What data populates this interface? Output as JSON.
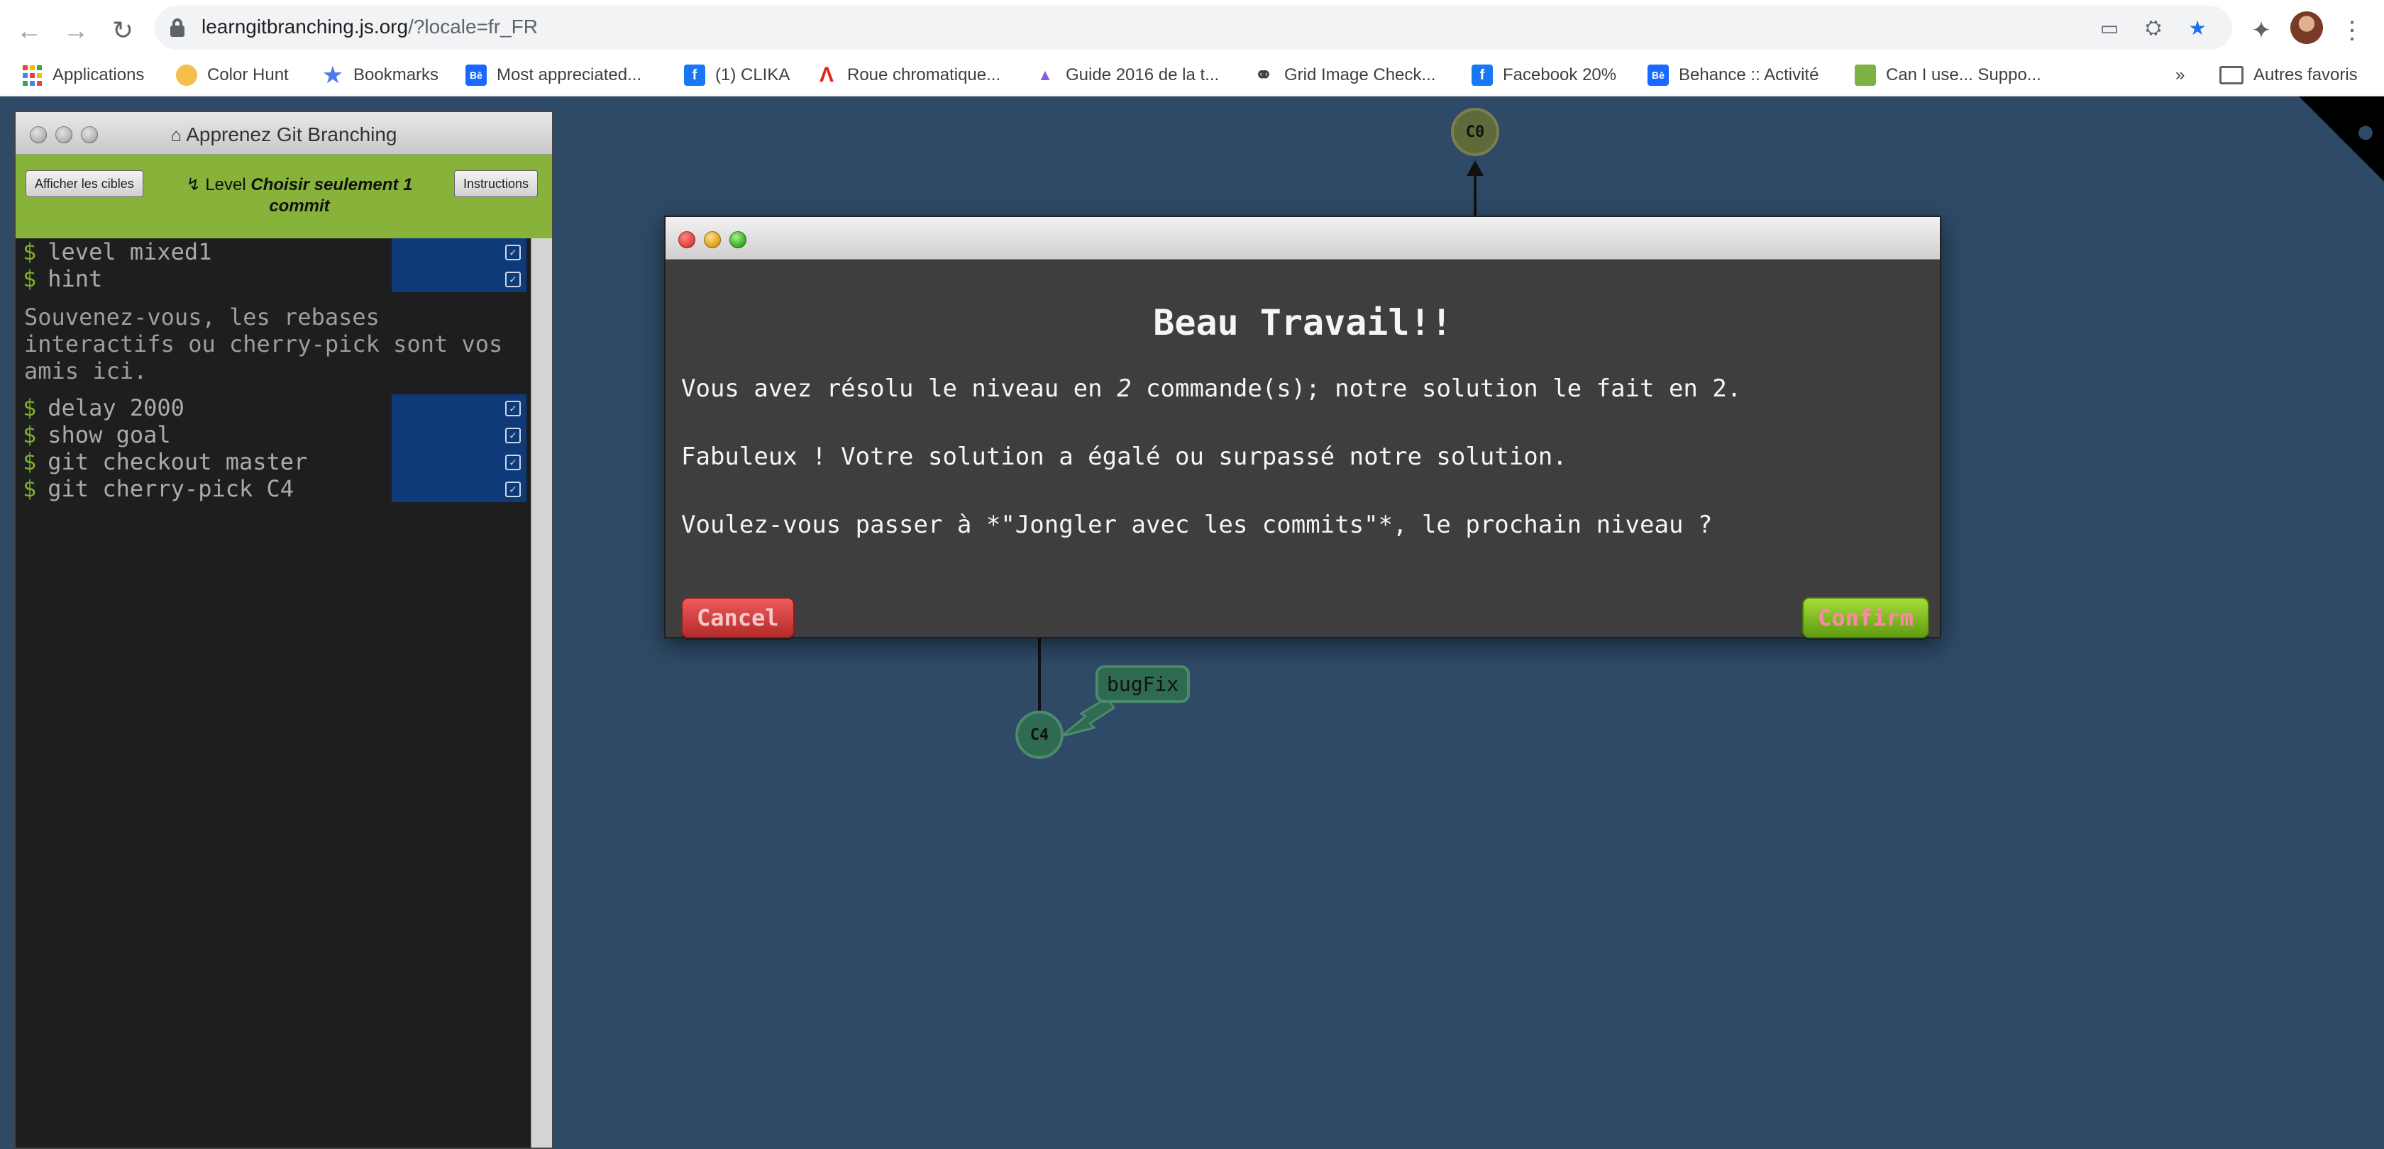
{
  "browser": {
    "url_host": "learngitbranching.js.org",
    "url_path": "/?locale=fr_FR",
    "bookmarks": [
      {
        "label": "Applications",
        "icon": "apps-grid-icon"
      },
      {
        "label": "Color Hunt",
        "icon": "color-hunt-icon"
      },
      {
        "label": "Bookmarks",
        "icon": "star-icon"
      },
      {
        "label": "Most appreciated...",
        "icon": "behance-icon"
      },
      {
        "label": "(1) CLIKA",
        "icon": "facebook-icon"
      },
      {
        "label": "Roue chromatique...",
        "icon": "adobe-icon"
      },
      {
        "label": "Guide 2016 de la t...",
        "icon": "mountain-icon"
      },
      {
        "label": "Grid Image Check...",
        "icon": "globe-icon"
      },
      {
        "label": "Facebook 20%",
        "icon": "facebook-icon"
      },
      {
        "label": "Behance :: Activité",
        "icon": "behance-icon"
      },
      {
        "label": "Can I use... Suppo...",
        "icon": "caniuse-icon"
      }
    ],
    "more_bookmarks": "»",
    "other_bookmarks": "Autres favoris"
  },
  "panel": {
    "title": "Apprenez Git Branching",
    "show_goal_button": "Afficher les cibles",
    "instructions_button": "Instructions",
    "level_prefix": "Level",
    "level_name": "Choisir seulement 1 commit",
    "commands": [
      {
        "text": "level mixed1"
      },
      {
        "text": "hint"
      },
      {
        "text": "delay 2000"
      },
      {
        "text": "show goal"
      },
      {
        "text": "git checkout master"
      },
      {
        "text": "git cherry-pick C4"
      }
    ],
    "prompt": "$",
    "hint_text": "Souvenez-vous, les rebases interactifs ou cherry-pick sont vos amis ici."
  },
  "graph": {
    "nodes": [
      {
        "id": "C0"
      },
      {
        "id": "C4"
      }
    ],
    "branches": [
      {
        "name": "bugFix",
        "target": "C4"
      }
    ]
  },
  "modal": {
    "heading": "Beau Travail!!",
    "line1_before": "Vous avez résolu le niveau en ",
    "line1_count": "2",
    "line1_after": " commande(s); notre solution le fait en 2.",
    "line2": "Fabuleux ! Votre solution a égalé ou surpassé notre solution.",
    "line3": "Voulez-vous passer à *\"Jongler avec les commits\"*, le prochain niveau ?",
    "cancel_label": "Cancel",
    "confirm_label": "Confirm"
  },
  "colors": {
    "viz_background": "#2e4a66",
    "level_bar": "#88b33a",
    "prompt": "#7ab02c",
    "cancel": "#c93838",
    "confirm": "#7cbf22"
  }
}
